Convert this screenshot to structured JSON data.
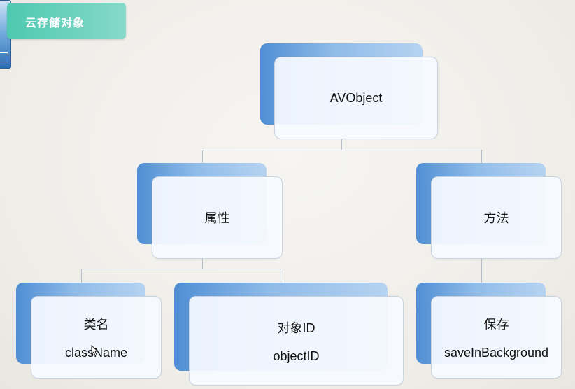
{
  "header": {
    "title": "云存储对象"
  },
  "diagram": {
    "root": {
      "label": "AVObject"
    },
    "properties": {
      "label": "属性"
    },
    "methods": {
      "label": "方法"
    },
    "class_name": {
      "label": "类名",
      "value": "className"
    },
    "object_id": {
      "label": "对象ID",
      "value": "objectID"
    },
    "save": {
      "label": "保存",
      "value": "saveInBackground"
    }
  }
}
